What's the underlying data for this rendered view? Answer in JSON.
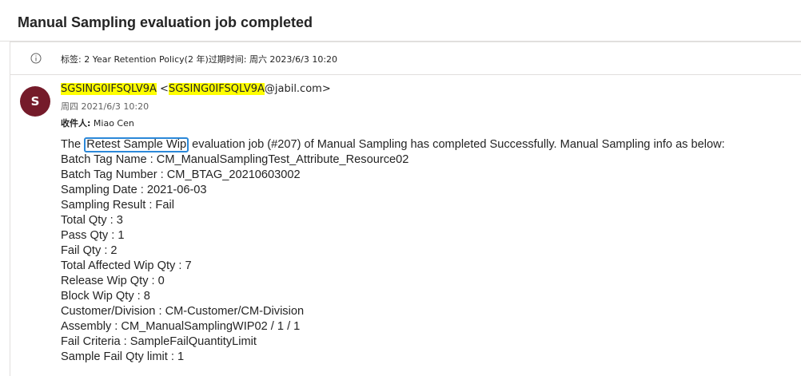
{
  "subject": "Manual Sampling evaluation job completed",
  "retention": {
    "icon": "info-icon",
    "text": "标签: 2 Year Retention Policy(2 年)过期时间: 周六 2023/6/3 10:20"
  },
  "sender": {
    "avatar_letter": "S",
    "avatar_color": "#751b2a",
    "name": "SGSING0IFSQLV9A",
    "email_prefix": " <",
    "email_user": "SGSING0IFSQLV9A",
    "email_domain": "@jabil.com>",
    "highlight_color": "#ffff00"
  },
  "date": "周四 2021/6/3 10:20",
  "recipients": {
    "label": "收件人:",
    "names": "Miao Cen"
  },
  "body": {
    "intro_prefix": "The ",
    "intro_highlight": "Retest Sample Wip",
    "intro_suffix": " evaluation job (#207) of Manual Sampling has completed Successfully. Manual Sampling info as below:",
    "highlight_border_color": "#2b88d8",
    "lines": [
      "Batch Tag Name : CM_ManualSamplingTest_Attribute_Resource02",
      "Batch Tag Number : CM_BTAG_20210603002",
      "Sampling Date : 2021-06-03",
      "Sampling Result : Fail",
      "Total Qty : 3",
      "Pass Qty : 1",
      "Fail Qty : 2",
      "Total Affected Wip Qty : 7",
      "Release Wip Qty : 0",
      "Block Wip Qty : 8",
      "Customer/Division : CM-Customer/CM-Division",
      "Assembly : CM_ManualSamplingWIP02 / 1 / 1",
      "Fail Criteria : SampleFailQuantityLimit",
      "Sample Fail Qty limit : 1"
    ]
  }
}
